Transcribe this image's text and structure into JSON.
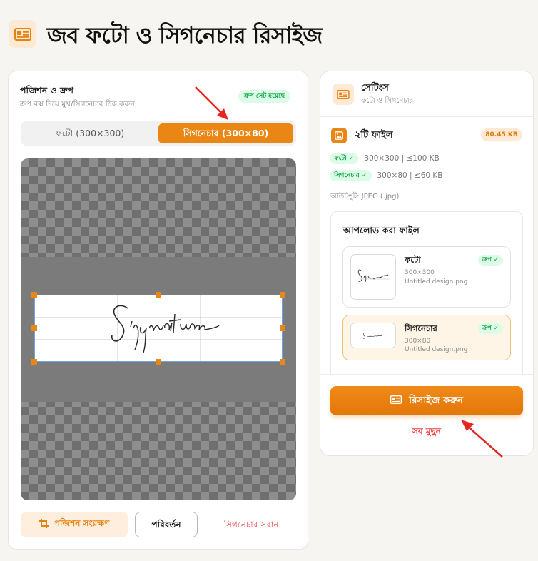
{
  "header": {
    "title": "জব ফটো ও সিগনেচার রিসাইজ",
    "icon": "id-card-icon"
  },
  "left_panel": {
    "title": "পজিশন ও ক্রপ",
    "subtitle": "ক্রপ বক্স দিয়ে মুখ/সিগনেচার ঠিক করুন",
    "badge": "ক্রপ সেট হয়েছে",
    "tabs": [
      {
        "label": "ফটো (300×300)",
        "active": false
      },
      {
        "label": "সিগনেচার (300×80)",
        "active": true
      }
    ],
    "signature_text": "Signature",
    "buttons": {
      "save": "পজিশন সংরক্ষণ",
      "change": "পরিবর্তন",
      "remove": "সিগনেচার সরান"
    }
  },
  "right_panel": {
    "title": "সেটিংস",
    "subtitle": "ফটো ও সিগনেচার",
    "files_title": "২টি ফাইল",
    "size_badge": "80.45 KB",
    "specs": [
      {
        "tag": "ফটো ✓",
        "text": "300×300 | ≤100 KB"
      },
      {
        "tag": "সিগনেচার ✓",
        "text": "300×80 | ≤60 KB"
      }
    ],
    "output_format": "আউটপুট: JPEG (.jpg)",
    "uploaded": {
      "title": "আপলোড করা ফাইল",
      "files": [
        {
          "name": "ফটো",
          "dims": "300×300",
          "filename": "Untitled design.png",
          "status": "ক্রপ ✓"
        },
        {
          "name": "সিগনেচার",
          "dims": "300×80",
          "filename": "Untitled design.png",
          "status": "ক্রপ ✓"
        }
      ]
    },
    "resize_button": "রিসাইজ করুন",
    "clear_button": "সব মুছুন"
  },
  "colors": {
    "accent": "#ea8613",
    "success": "#16a34a",
    "danger": "#ef4444",
    "annotation_arrow": "#e8251f"
  }
}
